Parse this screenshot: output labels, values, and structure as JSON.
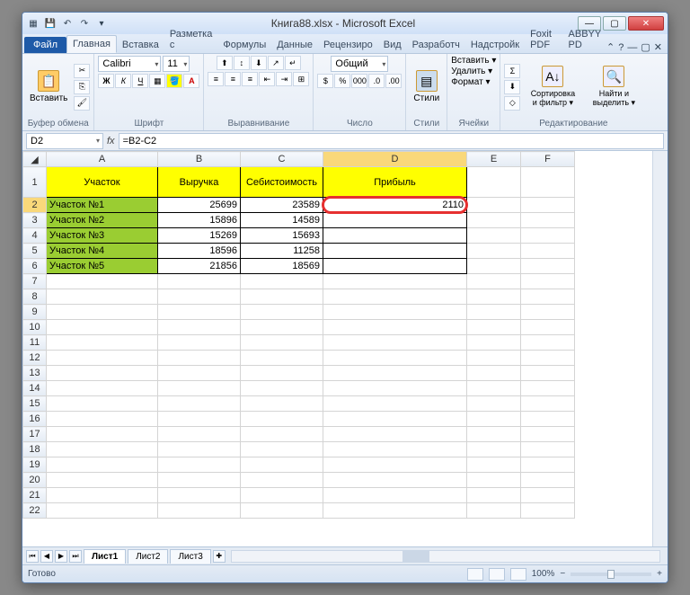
{
  "titlebar": {
    "title": "Книга88.xlsx - Microsoft Excel"
  },
  "tabs": {
    "file": "Файл",
    "items": [
      "Главная",
      "Вставка",
      "Разметка с",
      "Формулы",
      "Данные",
      "Рецензиро",
      "Вид",
      "Разработч",
      "Надстройк",
      "Foxit PDF",
      "ABBYY PD"
    ],
    "active": 0
  },
  "ribbon": {
    "clipboard": {
      "paste": "Вставить",
      "label": "Буфер обмена"
    },
    "font": {
      "name": "Calibri",
      "size": "11",
      "label": "Шрифт"
    },
    "align": {
      "label": "Выравнивание"
    },
    "number": {
      "format": "Общий",
      "label": "Число"
    },
    "styles": {
      "label": "Стили",
      "btn": "Стили"
    },
    "cells": {
      "insert": "Вставить ▾",
      "delete": "Удалить ▾",
      "format": "Формат ▾",
      "label": "Ячейки"
    },
    "editing": {
      "sort": "Сортировка и фильтр ▾",
      "find": "Найти и выделить ▾",
      "label": "Редактирование"
    }
  },
  "fbar": {
    "name": "D2",
    "fx": "fx",
    "formula": "=B2-C2"
  },
  "columns": [
    "A",
    "B",
    "C",
    "D",
    "E",
    "F"
  ],
  "headers": {
    "A": "Участок",
    "B": "Выручка",
    "C": "Себистоимость",
    "D": "Прибыль"
  },
  "rows": [
    {
      "A": "Участок №1",
      "B": "25699",
      "C": "23589",
      "D": "2110"
    },
    {
      "A": "Участок №2",
      "B": "15896",
      "C": "14589",
      "D": ""
    },
    {
      "A": "Участок №3",
      "B": "15269",
      "C": "15693",
      "D": ""
    },
    {
      "A": "Участок №4",
      "B": "18596",
      "C": "11258",
      "D": ""
    },
    {
      "A": "Участок №5",
      "B": "21856",
      "C": "18569",
      "D": ""
    }
  ],
  "sheets": {
    "items": [
      "Лист1",
      "Лист2",
      "Лист3"
    ],
    "active": 0
  },
  "status": {
    "ready": "Готово",
    "zoom": "100%"
  }
}
